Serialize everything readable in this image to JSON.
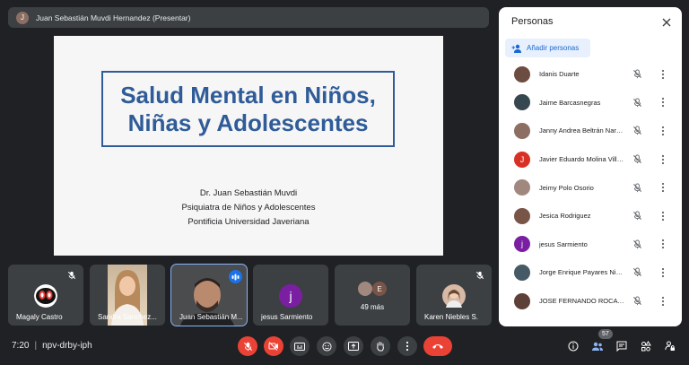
{
  "presenter": {
    "avatar_letter": "J",
    "label": "Juan Sebastián Muvdi Hernandez (Presentar)"
  },
  "slide": {
    "title_line1": "Salud Mental en Niños,",
    "title_line2": "Niñas y Adolescentes",
    "author": "Dr. Juan Sebastián Muvdi",
    "role": "Psiquiatra de Niños y Adolescentes",
    "university": "Pontificia Universidad Javeriana"
  },
  "tiles": [
    {
      "name": "Magaly Castro"
    },
    {
      "name": "Sandra Sanchez..."
    },
    {
      "name": "Juan Sebastián M..."
    },
    {
      "name": "jesus Sarmiento",
      "avatar_letter": "j"
    },
    {
      "name": "49 más",
      "avatar_letter": "E"
    },
    {
      "name": "Karen Niebles S."
    }
  ],
  "panel": {
    "title": "Personas",
    "add_label": "Añadir personas",
    "participants": [
      {
        "name": "Idanis Duarte",
        "color": "#6d4c41"
      },
      {
        "name": "Jaime Barcasnegras",
        "color": "#37474f"
      },
      {
        "name": "Janny Andrea Beltrán Naranjo",
        "color": "#8d6e63"
      },
      {
        "name": "Javier Eduardo Molina Villamil",
        "color": "#d93025",
        "letter": "J"
      },
      {
        "name": "Jeimy Polo Osorio",
        "color": "#a1887f"
      },
      {
        "name": "Jesica Rodriguez",
        "color": "#795548"
      },
      {
        "name": "jesus Sarmiento",
        "color": "#7b1fa2",
        "letter": "j"
      },
      {
        "name": "Jorge Enrique Payares Nieto",
        "color": "#455a64"
      },
      {
        "name": "JOSE FERNANDO ROCA MORENO",
        "color": "#5d4037"
      }
    ]
  },
  "meeting": {
    "time": "7:20",
    "separator": "|",
    "code": "npv-drby-iph"
  },
  "people_count": "57",
  "colors": {
    "accent": "#1a73e8",
    "danger": "#ea4335",
    "slide_blue": "#2f5c98"
  }
}
